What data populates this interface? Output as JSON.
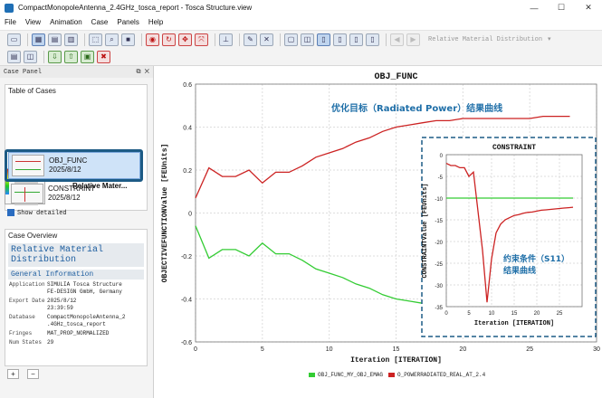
{
  "window": {
    "title": "CompactMonopoleAntenna_2.4GHz_tosca_report - Tosca Structure.view",
    "minimize": "—",
    "maximize": "☐",
    "close": "✕"
  },
  "menu": [
    "File",
    "View",
    "Animation",
    "Case",
    "Panels",
    "Help"
  ],
  "toolbar": {
    "result_combo": "Relative Material Distribution"
  },
  "case_panel": {
    "header": "Case Panel",
    "table_title": "Table of Cases",
    "cases": [
      {
        "name": "Relative Mater...",
        "date": ""
      },
      {
        "name": "OBJ_FUNC",
        "date": "2025/8/12"
      },
      {
        "name": "CONSTRAINT",
        "date": "2025/8/12"
      }
    ],
    "show_detailed": "Show detailed"
  },
  "overview": {
    "title": "Case Overview",
    "heading": "Relative Material Distribution",
    "section": "General Information",
    "rows": [
      {
        "k": "Application",
        "v": "SIMULIA Tosca Structure\nFE-DESIGN GmbH, Germany"
      },
      {
        "k": "Export Date",
        "v": "2025/8/12\n23:39:59"
      },
      {
        "k": "Database",
        "v": "CompactMonopoleAntenna_2\n.4GHz_tosca_report"
      },
      {
        "k": "Fringes",
        "v": "MAT_PROP_NORMALIZED"
      },
      {
        "k": "Num States",
        "v": "29"
      }
    ],
    "add": "+",
    "remove": "−"
  },
  "chart_data": [
    {
      "type": "line",
      "title": "OBJ_FUNC",
      "xlabel": "Iteration [ITERATION]",
      "ylabel": "OBJECTIVEFUNCTIONValue [FEUnits]",
      "xlim": [
        0,
        30
      ],
      "ylim": [
        -0.6,
        0.6
      ],
      "xticks": [
        0,
        5,
        10,
        15,
        20,
        25,
        30
      ],
      "yticks": [
        -0.6,
        -0.4,
        -0.2,
        0,
        0.2,
        0.4,
        0.6
      ],
      "series": [
        {
          "name": "OBJ_FUNC_MY_OBJ_EMAG",
          "color": "#33cc33",
          "x": [
            0,
            1,
            2,
            3,
            4,
            5,
            6,
            7,
            8,
            9,
            10,
            11,
            12,
            13,
            14,
            15,
            16,
            17,
            18,
            19,
            20,
            21,
            22,
            23,
            24,
            25,
            26,
            27,
            28
          ],
          "y": [
            -0.06,
            -0.21,
            -0.17,
            -0.17,
            -0.2,
            -0.14,
            -0.19,
            -0.19,
            -0.22,
            -0.26,
            -0.28,
            -0.3,
            -0.33,
            -0.35,
            -0.38,
            -0.4,
            -0.41,
            -0.42,
            -0.43,
            -0.43,
            -0.44,
            -0.44,
            -0.44,
            -0.44,
            -0.44,
            -0.44,
            -0.44,
            -0.44,
            -0.44
          ]
        },
        {
          "name": "O_POWERRADIATED_REAL_AT_2.4",
          "color": "#cc2222",
          "x": [
            0,
            1,
            2,
            3,
            4,
            5,
            6,
            7,
            8,
            9,
            10,
            11,
            12,
            13,
            14,
            15,
            16,
            17,
            18,
            19,
            20,
            21,
            22,
            23,
            24,
            25,
            26,
            27,
            28
          ],
          "y": [
            0.07,
            0.21,
            0.17,
            0.17,
            0.2,
            0.14,
            0.19,
            0.19,
            0.22,
            0.26,
            0.28,
            0.3,
            0.33,
            0.35,
            0.38,
            0.4,
            0.41,
            0.42,
            0.43,
            0.43,
            0.44,
            0.44,
            0.44,
            0.44,
            0.44,
            0.44,
            0.45,
            0.45,
            0.45
          ]
        }
      ],
      "annotation": "优化目标（Radiated Power）结果曲线"
    },
    {
      "type": "line",
      "title": "CONSTRAINT",
      "xlabel": "Iteration [ITERATION]",
      "ylabel": "CONSTRAINTValue [FEUnits]",
      "xlim": [
        0,
        30
      ],
      "ylim": [
        -35,
        0
      ],
      "xticks": [
        0,
        5,
        10,
        15,
        20,
        25
      ],
      "yticks": [
        0,
        -5,
        -10,
        -15,
        -20,
        -25,
        -30,
        -35
      ],
      "series": [
        {
          "name": "",
          "color": "#33cc33",
          "x": [
            0,
            28
          ],
          "y": [
            -10,
            -10
          ]
        },
        {
          "name": "",
          "color": "#cc2222",
          "x": [
            0,
            1,
            2,
            3,
            4,
            5,
            6,
            7,
            8,
            9,
            10,
            11,
            12,
            13,
            14,
            15,
            16,
            17,
            18,
            19,
            20,
            21,
            22,
            23,
            24,
            25,
            26,
            27,
            28
          ],
          "y": [
            -2,
            -2.5,
            -2.5,
            -3,
            -3,
            -5,
            -4,
            -13,
            -22,
            -34,
            -24,
            -18,
            -16,
            -15,
            -14.5,
            -14,
            -13.8,
            -13.5,
            -13.3,
            -13.2,
            -13,
            -12.8,
            -12.7,
            -12.6,
            -12.5,
            -12.4,
            -12.3,
            -12.2,
            -12.1
          ]
        }
      ],
      "annotation": "约束条件（S11）\n结果曲线"
    }
  ]
}
